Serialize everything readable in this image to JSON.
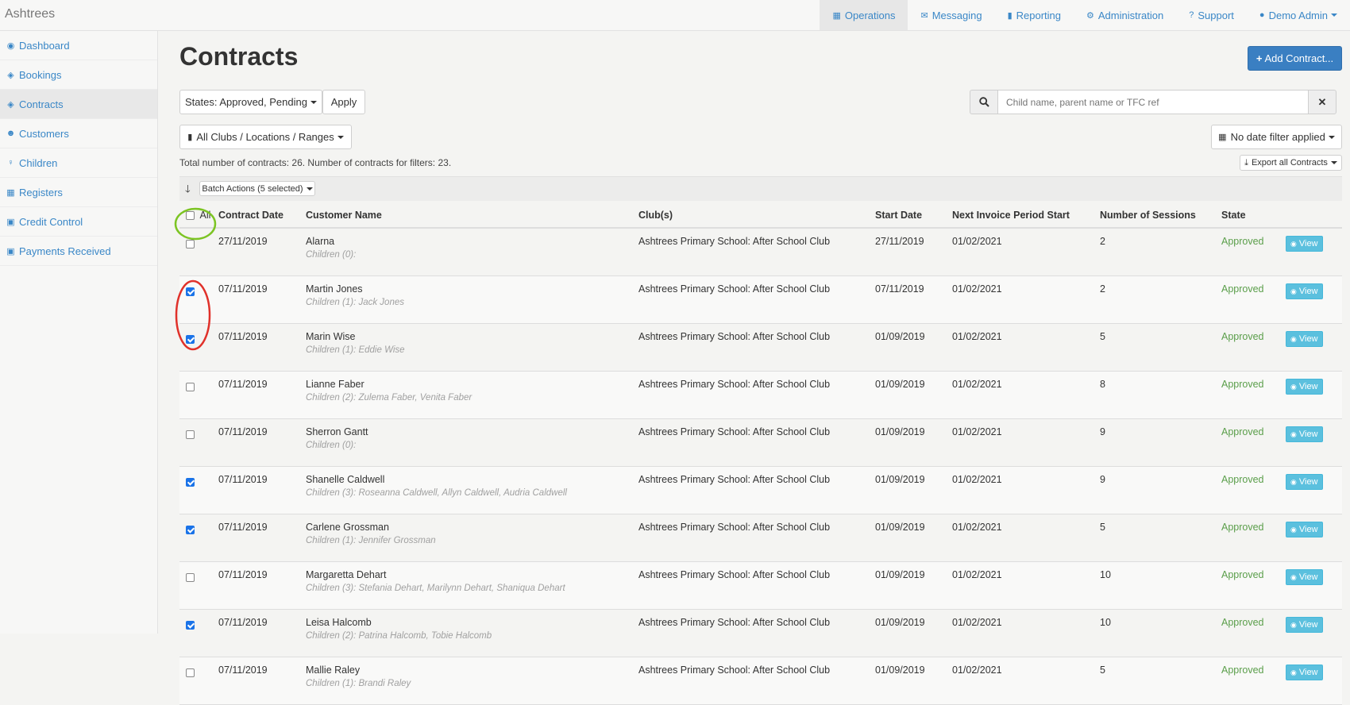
{
  "app": {
    "brand": "Ashtrees"
  },
  "topnav": [
    {
      "label": "Operations",
      "icon": "th-icon",
      "glyph": "▦",
      "active": true
    },
    {
      "label": "Messaging",
      "icon": "envelope-icon",
      "glyph": "✉",
      "active": false
    },
    {
      "label": "Reporting",
      "icon": "bar-chart-icon",
      "glyph": "▮",
      "active": false
    },
    {
      "label": "Administration",
      "icon": "gear-icon",
      "glyph": "⚙",
      "active": false
    },
    {
      "label": "Support",
      "icon": "question-icon",
      "glyph": "?",
      "active": false
    },
    {
      "label": "Demo Admin",
      "icon": "user-icon",
      "glyph": "●",
      "active": false,
      "dropdown": true
    }
  ],
  "sidebar": [
    {
      "label": "Dashboard",
      "icon": "dashboard-icon",
      "glyph": "◉"
    },
    {
      "label": "Bookings",
      "icon": "tag-icon",
      "glyph": "◈"
    },
    {
      "label": "Contracts",
      "icon": "tag-icon",
      "glyph": "◈",
      "active": true
    },
    {
      "label": "Customers",
      "icon": "users-icon",
      "glyph": "☻"
    },
    {
      "label": "Children",
      "icon": "child-icon",
      "glyph": "♀"
    },
    {
      "label": "Registers",
      "icon": "calendar-icon",
      "glyph": "▦"
    },
    {
      "label": "Credit Control",
      "icon": "money-icon",
      "glyph": "▣"
    },
    {
      "label": "Payments Received",
      "icon": "money-icon",
      "glyph": "▣"
    }
  ],
  "page": {
    "title": "Contracts",
    "add_button": "Add Contract...",
    "states_filter": "States: Approved, Pending",
    "apply": "Apply",
    "search_placeholder": "Child name, parent name or TFC ref",
    "clubs_filter": "All Clubs / Locations / Ranges",
    "date_filter": "No date filter applied",
    "summary": "Total number of contracts: 26. Number of contracts for filters: 23.",
    "export": "Export all Contracts",
    "batch_actions": "Batch Actions (5 selected)"
  },
  "table": {
    "headers": {
      "all": "All",
      "contract_date": "Contract Date",
      "customer_name": "Customer Name",
      "clubs": "Club(s)",
      "start_date": "Start Date",
      "next_invoice": "Next Invoice Period Start",
      "sessions": "Number of Sessions",
      "state": "State"
    },
    "view_label": "View",
    "rows": [
      {
        "checked": false,
        "contract_date": "27/11/2019",
        "customer": "Alarna",
        "children": "Children (0):",
        "club": "Ashtrees Primary School: After School Club",
        "start": "27/11/2019",
        "next_invoice": "01/02/2021",
        "sessions": "2",
        "state": "Approved"
      },
      {
        "checked": true,
        "contract_date": "07/11/2019",
        "customer": "Martin Jones",
        "children": "Children (1): Jack Jones",
        "club": "Ashtrees Primary School: After School Club",
        "start": "07/11/2019",
        "next_invoice": "01/02/2021",
        "sessions": "2",
        "state": "Approved"
      },
      {
        "checked": true,
        "contract_date": "07/11/2019",
        "customer": "Marin Wise",
        "children": "Children (1): Eddie Wise",
        "club": "Ashtrees Primary School: After School Club",
        "start": "01/09/2019",
        "next_invoice": "01/02/2021",
        "sessions": "5",
        "state": "Approved"
      },
      {
        "checked": false,
        "contract_date": "07/11/2019",
        "customer": "Lianne Faber",
        "children": "Children (2): Zulema Faber, Venita Faber",
        "club": "Ashtrees Primary School: After School Club",
        "start": "01/09/2019",
        "next_invoice": "01/02/2021",
        "sessions": "8",
        "state": "Approved"
      },
      {
        "checked": false,
        "contract_date": "07/11/2019",
        "customer": "Sherron Gantt",
        "children": "Children (0):",
        "club": "Ashtrees Primary School: After School Club",
        "start": "01/09/2019",
        "next_invoice": "01/02/2021",
        "sessions": "9",
        "state": "Approved"
      },
      {
        "checked": true,
        "contract_date": "07/11/2019",
        "customer": "Shanelle Caldwell",
        "children": "Children (3): Roseanna Caldwell, Allyn Caldwell, Audria Caldwell",
        "club": "Ashtrees Primary School: After School Club",
        "start": "01/09/2019",
        "next_invoice": "01/02/2021",
        "sessions": "9",
        "state": "Approved"
      },
      {
        "checked": true,
        "contract_date": "07/11/2019",
        "customer": "Carlene Grossman",
        "children": "Children (1): Jennifer Grossman",
        "club": "Ashtrees Primary School: After School Club",
        "start": "01/09/2019",
        "next_invoice": "01/02/2021",
        "sessions": "5",
        "state": "Approved"
      },
      {
        "checked": false,
        "contract_date": "07/11/2019",
        "customer": "Margaretta Dehart",
        "children": "Children (3): Stefania Dehart, Marilynn Dehart, Shaniqua Dehart",
        "club": "Ashtrees Primary School: After School Club",
        "start": "01/09/2019",
        "next_invoice": "01/02/2021",
        "sessions": "10",
        "state": "Approved"
      },
      {
        "checked": true,
        "contract_date": "07/11/2019",
        "customer": "Leisa Halcomb",
        "children": "Children (2): Patrina Halcomb, Tobie Halcomb",
        "club": "Ashtrees Primary School: After School Club",
        "start": "01/09/2019",
        "next_invoice": "01/02/2021",
        "sessions": "10",
        "state": "Approved"
      },
      {
        "checked": false,
        "contract_date": "07/11/2019",
        "customer": "Mallie Raley",
        "children": "Children (1): Brandi Raley",
        "club": "Ashtrees Primary School: After School Club",
        "start": "01/09/2019",
        "next_invoice": "01/02/2021",
        "sessions": "5",
        "state": "Approved"
      }
    ]
  },
  "annotations": {
    "green": "#7cc423",
    "red": "#e0312a"
  },
  "colors": {
    "link": "#3a87c7",
    "primary": "#3a7fc2",
    "approved": "#5a9e4a",
    "view_button": "#5bc0de"
  }
}
